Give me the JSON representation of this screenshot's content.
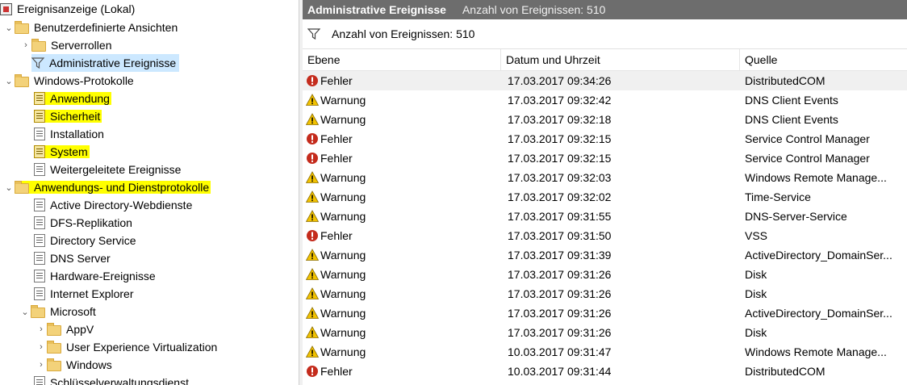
{
  "tree": {
    "root": "Ereignisanzeige (Lokal)",
    "custom_views": "Benutzerdefinierte Ansichten",
    "server_roles": "Serverrollen",
    "admin_events": "Administrative Ereignisse",
    "windows_logs": "Windows-Protokolle",
    "application": "Anwendung",
    "security": "Sicherheit",
    "installation": "Installation",
    "system": "System",
    "forwarded": "Weitergeleitete Ereignisse",
    "app_service_logs": "Anwendungs- und Dienstprotokolle",
    "active_directory_web": "Active Directory-Webdienste",
    "dfs_replication": "DFS-Replikation",
    "directory_service": "Directory Service",
    "dns_server": "DNS Server",
    "hardware_events": "Hardware-Ereignisse",
    "internet_explorer": "Internet Explorer",
    "microsoft": "Microsoft",
    "appv": "AppV",
    "uev": "User Experience Virtualization",
    "windows": "Windows",
    "key_management": "Schlüsselverwaltungsdienst"
  },
  "header": {
    "title": "Administrative Ereignisse",
    "count": "Anzahl von Ereignissen: 510"
  },
  "filterbar": {
    "text": "Anzahl von Ereignissen: 510"
  },
  "columns": {
    "level": "Ebene",
    "datetime": "Datum und Uhrzeit",
    "source": "Quelle"
  },
  "events": [
    {
      "level": "Fehler",
      "type": "error",
      "datetime": "17.03.2017 09:34:26",
      "source": "DistributedCOM"
    },
    {
      "level": "Warnung",
      "type": "warning",
      "datetime": "17.03.2017 09:32:42",
      "source": "DNS Client Events"
    },
    {
      "level": "Warnung",
      "type": "warning",
      "datetime": "17.03.2017 09:32:18",
      "source": "DNS Client Events"
    },
    {
      "level": "Fehler",
      "type": "error",
      "datetime": "17.03.2017 09:32:15",
      "source": "Service Control Manager"
    },
    {
      "level": "Fehler",
      "type": "error",
      "datetime": "17.03.2017 09:32:15",
      "source": "Service Control Manager"
    },
    {
      "level": "Warnung",
      "type": "warning",
      "datetime": "17.03.2017 09:32:03",
      "source": "Windows Remote Manage..."
    },
    {
      "level": "Warnung",
      "type": "warning",
      "datetime": "17.03.2017 09:32:02",
      "source": "Time-Service"
    },
    {
      "level": "Warnung",
      "type": "warning",
      "datetime": "17.03.2017 09:31:55",
      "source": "DNS-Server-Service"
    },
    {
      "level": "Fehler",
      "type": "error",
      "datetime": "17.03.2017 09:31:50",
      "source": "VSS"
    },
    {
      "level": "Warnung",
      "type": "warning",
      "datetime": "17.03.2017 09:31:39",
      "source": "ActiveDirectory_DomainSer..."
    },
    {
      "level": "Warnung",
      "type": "warning",
      "datetime": "17.03.2017 09:31:26",
      "source": "Disk"
    },
    {
      "level": "Warnung",
      "type": "warning",
      "datetime": "17.03.2017 09:31:26",
      "source": "Disk"
    },
    {
      "level": "Warnung",
      "type": "warning",
      "datetime": "17.03.2017 09:31:26",
      "source": "ActiveDirectory_DomainSer..."
    },
    {
      "level": "Warnung",
      "type": "warning",
      "datetime": "17.03.2017 09:31:26",
      "source": "Disk"
    },
    {
      "level": "Warnung",
      "type": "warning",
      "datetime": "10.03.2017 09:31:47",
      "source": "Windows Remote Manage..."
    },
    {
      "level": "Fehler",
      "type": "error",
      "datetime": "10.03.2017 09:31:44",
      "source": "DistributedCOM"
    }
  ],
  "colors": {
    "highlight": "#ffff00",
    "selected": "#cce8ff",
    "header_bg": "#6d6d6d",
    "error": "#c42b1c",
    "warning": "#f2c200"
  }
}
